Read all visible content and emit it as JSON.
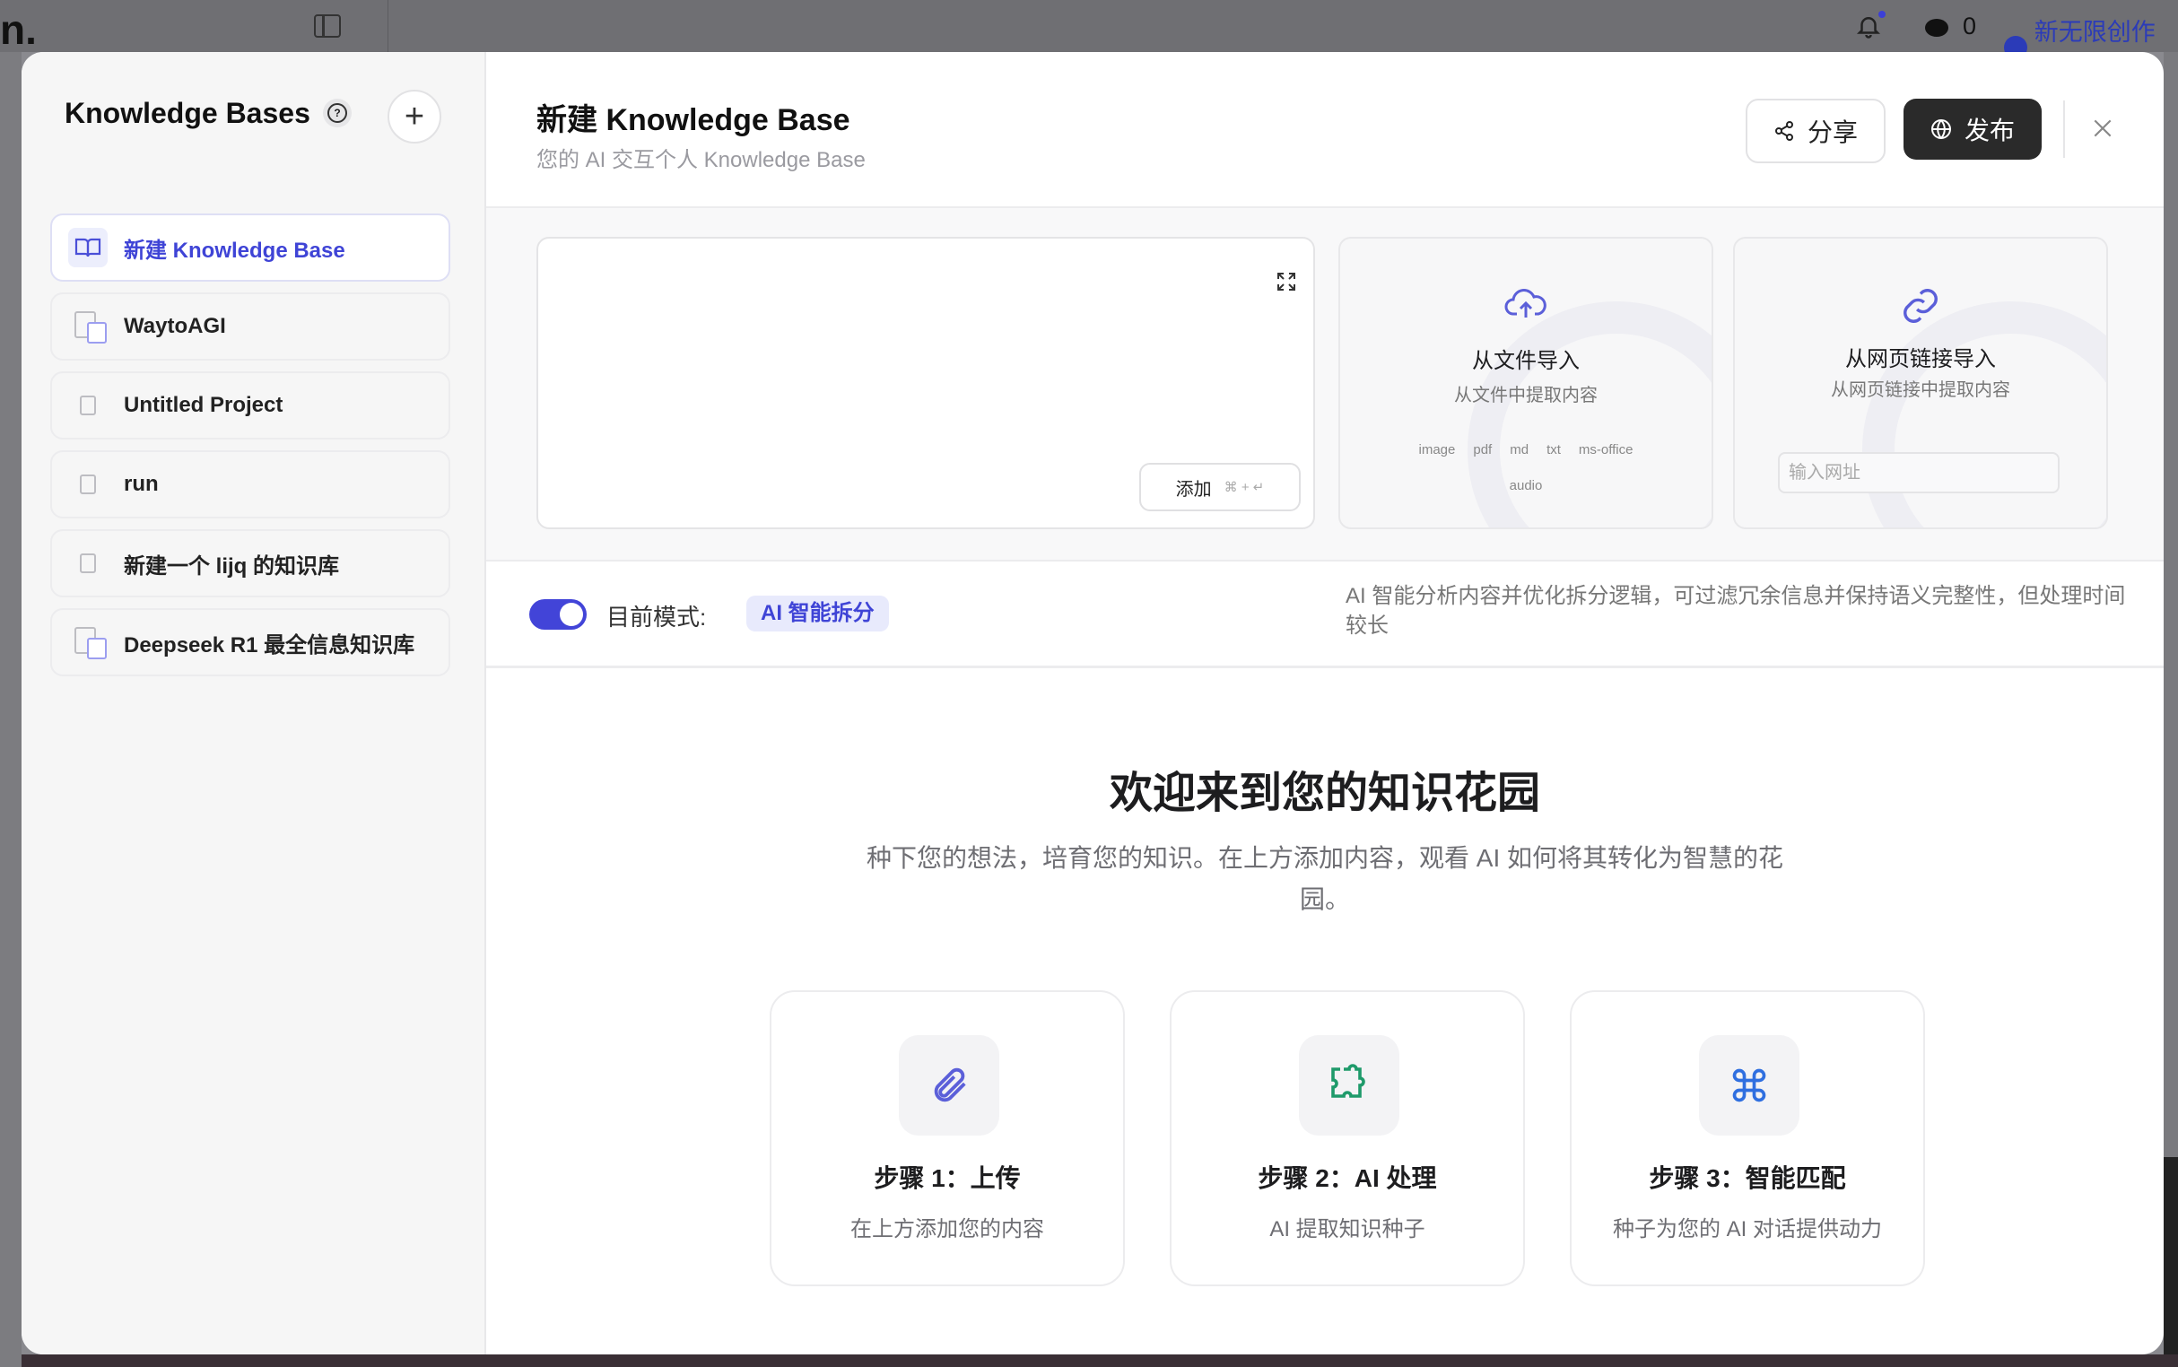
{
  "background_app": {
    "logo": "n.",
    "points": "0",
    "promo": "新无限创作包"
  },
  "sidebar": {
    "title": "Knowledge Bases",
    "items": [
      {
        "label": "新建 Knowledge Base",
        "active": true
      },
      {
        "label": "WaytoAGI"
      },
      {
        "label": "Untitled Project"
      },
      {
        "label": "run"
      },
      {
        "label": "新建一个 lijq 的知识库"
      },
      {
        "label": "Deepseek R1 最全信息知识库"
      }
    ]
  },
  "header": {
    "title": "新建 Knowledge Base",
    "subtitle": "您的 AI 交互个人 Knowledge Base",
    "share_label": "分享",
    "publish_label": "发布"
  },
  "input": {
    "add_label": "添加",
    "add_shortcut": "⌘ + ↵"
  },
  "file_import": {
    "title": "从文件导入",
    "subtitle": "从文件中提取内容",
    "types": [
      "image",
      "pdf",
      "md",
      "txt",
      "ms-office",
      "audio"
    ]
  },
  "web_import": {
    "title": "从网页链接导入",
    "subtitle": "从网页链接中提取内容",
    "url_placeholder": "输入网址"
  },
  "mode": {
    "label": "目前模式:",
    "badge": "AI 智能拆分",
    "enabled": true,
    "description": "AI 智能分析内容并优化拆分逻辑，可过滤冗余信息并保持语义完整性，但处理时间较长"
  },
  "welcome": {
    "title": "欢迎来到您的知识花园",
    "description": "种下您的想法，培育您的知识。在上方添加内容，观看 AI 如何将其转化为智慧的花园。",
    "steps": [
      {
        "title": "步骤 1：上传",
        "desc": "在上方添加您的内容",
        "icon": "paperclip-icon",
        "color": "#5b5fd9"
      },
      {
        "title": "步骤 2：AI 处理",
        "desc": "AI 提取知识种子",
        "icon": "puzzle-icon",
        "color": "#1e9a6a"
      },
      {
        "title": "步骤 3：智能匹配",
        "desc": "种子为您的 AI 对话提供动力",
        "icon": "command-icon",
        "color": "#2f6fe0"
      }
    ]
  }
}
